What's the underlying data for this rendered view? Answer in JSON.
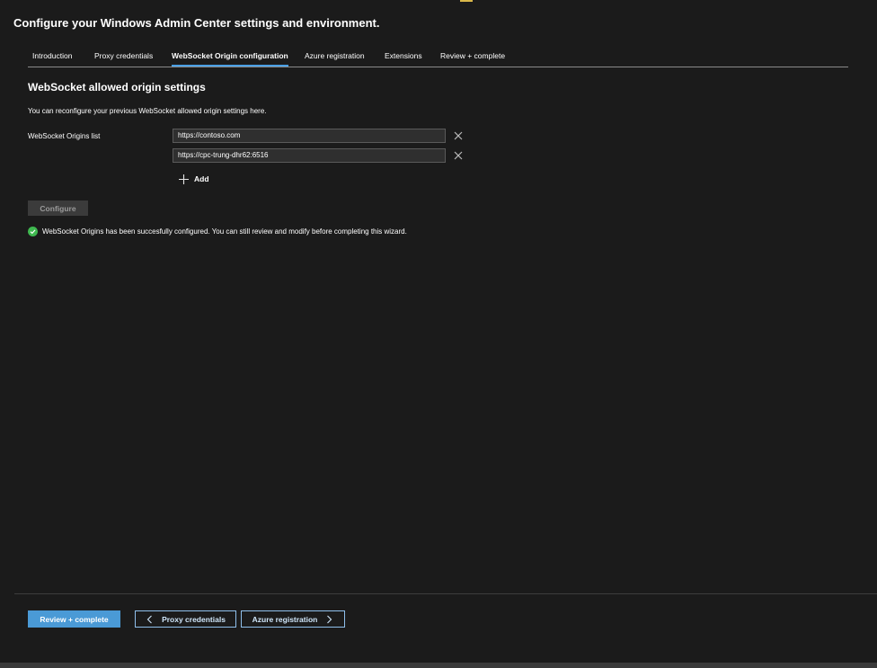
{
  "header": {
    "title": "Configure your Windows Admin Center settings and environment."
  },
  "tabs": [
    {
      "label": "Introduction",
      "active": false
    },
    {
      "label": "Proxy credentials",
      "active": false
    },
    {
      "label": "WebSocket Origin configuration",
      "active": true
    },
    {
      "label": "Azure registration",
      "active": false
    },
    {
      "label": "Extensions",
      "active": false
    },
    {
      "label": "Review + complete",
      "active": false
    }
  ],
  "main": {
    "section_title": "WebSocket allowed origin settings",
    "description": "You can reconfigure your previous WebSocket allowed origin settings here.",
    "origins_label": "WebSocket Origins list",
    "origins": [
      {
        "value": "https://contoso.com"
      },
      {
        "value": "https://cpc-trung-dhr62:6516"
      }
    ],
    "add_label": "Add",
    "configure_label": "Configure",
    "status_message": "WebSocket Origins has been succesfully configured. You can still review and modify before completing this wizard."
  },
  "footer": {
    "review_label": "Review + complete",
    "prev_label": "Proxy credentials",
    "next_label": "Azure registration"
  },
  "icons": {
    "remove": "close-icon",
    "add": "plus-icon",
    "success": "checkmark-circle-icon",
    "prev": "chevron-left-icon",
    "next": "chevron-right-icon"
  },
  "colors": {
    "background": "#1b1b1b",
    "accent": "#4a9ad6",
    "tab_underline": "#4aa0e6",
    "success": "#3fb950",
    "input_bg": "#2f2f2f"
  }
}
